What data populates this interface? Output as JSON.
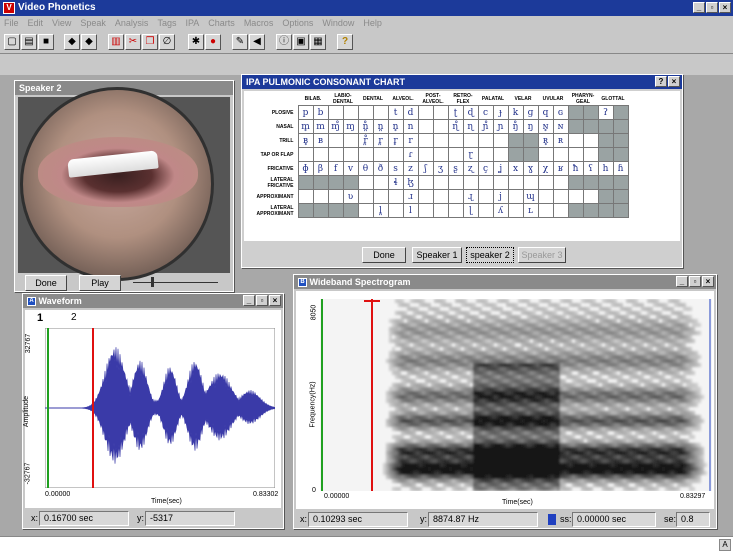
{
  "app": {
    "title": "Video Phonetics",
    "menu": [
      "File",
      "Edit",
      "View",
      "Speak",
      "Analysis",
      "Tags",
      "IPA",
      "Charts",
      "Macros",
      "Options",
      "Window",
      "Help"
    ]
  },
  "toolbar": {
    "buttons": [
      "new",
      "open",
      "save",
      "prev",
      "next",
      "chart",
      "cut",
      "copy",
      "draw",
      "settings",
      "record",
      "pen",
      "speaker",
      "info",
      "window",
      "grid",
      "help"
    ]
  },
  "speaker_window": {
    "title": "Speaker 2",
    "done_label": "Done",
    "play_label": "Play"
  },
  "ipa_window": {
    "title": "IPA PULMONIC CONSONANT CHART",
    "columns": [
      "BILAB.",
      "LABIO-DENTAL",
      "DENTAL",
      "ALVEOL.",
      "POST-ALVEOL.",
      "RETRO-FLEX",
      "PALATAL",
      "VELAR",
      "UVULAR",
      "PHARYN-GEAL",
      "GLOTTAL"
    ],
    "rows": [
      {
        "label": "PLOSIVE",
        "cells": [
          "p",
          "b",
          "",
          "",
          "",
          "",
          "t",
          "d",
          "",
          "",
          "ʈ",
          "ɖ",
          "c",
          "ɟ",
          "k",
          "ɡ",
          "q",
          "ɢ",
          "",
          "",
          "ʔ",
          ""
        ],
        "shade": [
          0,
          0,
          0,
          0,
          0,
          0,
          0,
          0,
          0,
          0,
          0,
          0,
          0,
          0,
          0,
          0,
          0,
          0,
          1,
          1,
          0,
          1
        ]
      },
      {
        "label": "NASAL",
        "cells": [
          "m̥",
          "m",
          "ɱ̊",
          "ɱ",
          "n̪̊",
          "n̪",
          "n̥",
          "n",
          "",
          "",
          "ɳ̊",
          "ɳ",
          "ɲ̊",
          "ɲ",
          "ŋ̊",
          "ŋ",
          "ɴ̥",
          "ɴ",
          "",
          "",
          "",
          ""
        ],
        "shade": [
          0,
          0,
          0,
          0,
          0,
          0,
          0,
          0,
          0,
          0,
          0,
          0,
          0,
          0,
          0,
          0,
          0,
          0,
          1,
          1,
          1,
          1
        ]
      },
      {
        "label": "TRILL",
        "cells": [
          "ʙ̥",
          "ʙ",
          "",
          "",
          "r̪̊",
          "r̪",
          "r̥",
          "r",
          "",
          "",
          "",
          "",
          "",
          "",
          "",
          "",
          "ʀ̥",
          "ʀ",
          "",
          "",
          "",
          ""
        ],
        "shade": [
          0,
          0,
          0,
          0,
          0,
          0,
          0,
          0,
          0,
          0,
          0,
          0,
          0,
          0,
          1,
          1,
          0,
          0,
          0,
          0,
          1,
          1
        ]
      },
      {
        "label": "TAP OR FLAP",
        "cells": [
          "",
          "",
          "",
          "",
          "",
          "",
          "",
          "ɾ",
          "",
          "",
          "",
          "ɽ",
          "",
          "",
          "",
          "",
          "",
          "",
          "",
          "",
          "",
          ""
        ],
        "shade": [
          0,
          0,
          0,
          0,
          0,
          0,
          0,
          0,
          0,
          0,
          0,
          0,
          0,
          0,
          1,
          1,
          0,
          0,
          0,
          0,
          1,
          1
        ]
      },
      {
        "label": "FRICATIVE",
        "cells": [
          "ɸ",
          "β",
          "f",
          "v",
          "θ",
          "ð",
          "s",
          "z",
          "ʃ",
          "ʒ",
          "ʂ",
          "ʐ",
          "ç",
          "ʝ",
          "x",
          "ɣ",
          "χ",
          "ʁ",
          "ħ",
          "ʕ",
          "h",
          "ɦ"
        ],
        "shade": [
          0,
          0,
          0,
          0,
          0,
          0,
          0,
          0,
          0,
          0,
          0,
          0,
          0,
          0,
          0,
          0,
          0,
          0,
          0,
          0,
          0,
          0
        ]
      },
      {
        "label": "LATERAL FRICATIVE",
        "cells": [
          "",
          "",
          "",
          "",
          "",
          "",
          "ɬ",
          "ɮ",
          "",
          "",
          "",
          "",
          "",
          "",
          "",
          "",
          "",
          "",
          "",
          "",
          "",
          ""
        ],
        "shade": [
          1,
          1,
          1,
          1,
          0,
          0,
          0,
          0,
          0,
          0,
          0,
          0,
          0,
          0,
          0,
          0,
          0,
          0,
          1,
          1,
          1,
          1
        ]
      },
      {
        "label": "APPROXIMANT",
        "cells": [
          "",
          "",
          "",
          "ʋ",
          "",
          "",
          "",
          "ɹ",
          "",
          "",
          "",
          "ɻ",
          "",
          "j",
          "",
          "ɰ",
          "",
          "",
          "",
          "",
          "",
          ""
        ],
        "shade": [
          0,
          0,
          0,
          0,
          0,
          0,
          0,
          0,
          0,
          0,
          0,
          0,
          0,
          0,
          0,
          0,
          0,
          0,
          0,
          0,
          1,
          1
        ]
      },
      {
        "label": "LATERAL APPROXIMANT",
        "cells": [
          "",
          "",
          "",
          "",
          "",
          "l̪",
          "",
          "l",
          "",
          "",
          "",
          "ɭ",
          "",
          "ʎ",
          "",
          "ʟ",
          "",
          "",
          "",
          "",
          "",
          ""
        ],
        "shade": [
          1,
          1,
          1,
          1,
          0,
          0,
          0,
          0,
          0,
          0,
          0,
          0,
          0,
          0,
          0,
          0,
          0,
          0,
          1,
          1,
          1,
          1
        ]
      }
    ],
    "buttons": [
      "Done",
      "Speaker 1",
      "speaker 2",
      "Speaker 3"
    ]
  },
  "waveform_window": {
    "title": "Waveform",
    "marker_labels": [
      "1",
      "2"
    ],
    "y_top": "32767",
    "y_bottom": "-32767",
    "ylabel": "Amplitude",
    "x_start": "0.00000",
    "x_end": "0.83302",
    "xlabel": "Time(sec)",
    "x_field_label": "x:",
    "x_value": "0.16700 sec",
    "y_field_label": "y:",
    "y_value": "-5317"
  },
  "spectrogram_window": {
    "title": "Wideband Spectrogram",
    "y_top": "8050",
    "y_bottom": "0",
    "ylabel": "Frequency(Hz)",
    "x_start": "0.00000",
    "x_end": "0.83297",
    "xlabel": "Time(sec)",
    "x_field_label": "x:",
    "x_value": "0.10293 sec",
    "y_field_label": "y:",
    "y_value": "8874.87 Hz",
    "ss_label": "ss:",
    "ss_value": "0.00000 sec",
    "se_label": "se:",
    "se_value": "0.8"
  },
  "colors": {
    "titlebar_active": "#1c3a9a",
    "waveform": "#3a3aa8",
    "cursor_red": "#e01010",
    "cursor_green": "#20a020",
    "chart_shade": "#9aa3a3"
  }
}
